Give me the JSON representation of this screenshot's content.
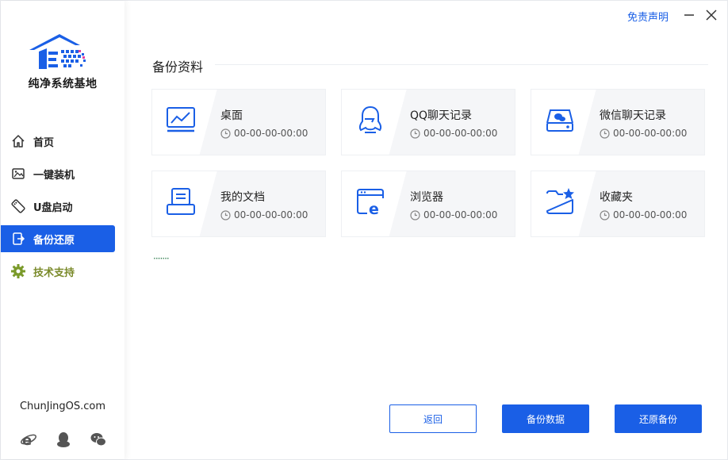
{
  "app": {
    "logo_text": "纯净系统基地",
    "site": "ChunJingOS.com",
    "disclaimer": "免责声明"
  },
  "sidebar": {
    "items": [
      {
        "label": "首页",
        "icon": "home-icon"
      },
      {
        "label": "一键装机",
        "icon": "image-install-icon"
      },
      {
        "label": "U盘启动",
        "icon": "usb-icon"
      },
      {
        "label": "备份还原",
        "icon": "backup-restore-icon"
      },
      {
        "label": "技术支持",
        "icon": "gear-icon"
      }
    ],
    "active_index": 3
  },
  "social": [
    "ie-browser-icon",
    "qq-icon",
    "wechat-icon"
  ],
  "main": {
    "section_title": "备份资料",
    "cards": [
      {
        "title": "桌面",
        "time": "00-00-00-00:00",
        "icon": "desktop-chart-icon"
      },
      {
        "title": "QQ聊天记录",
        "time": "00-00-00-00:00",
        "icon": "qq-penguin-icon"
      },
      {
        "title": "微信聊天记录",
        "time": "00-00-00-00:00",
        "icon": "hard-drive-icon"
      },
      {
        "title": "我的文档",
        "time": "00-00-00-00:00",
        "icon": "document-printer-icon"
      },
      {
        "title": "浏览器",
        "time": "00-00-00-00:00",
        "icon": "browser-e-icon"
      },
      {
        "title": "收藏夹",
        "time": "00-00-00-00:00",
        "icon": "favorites-folder-icon"
      }
    ],
    "loading": "·······"
  },
  "buttons": {
    "back": "返回",
    "backup": "备份数据",
    "restore": "还原备份"
  },
  "colors": {
    "accent": "#1a5fe6",
    "support_text": "#7a8a2a",
    "loading_dots": "#2c7a4b"
  }
}
